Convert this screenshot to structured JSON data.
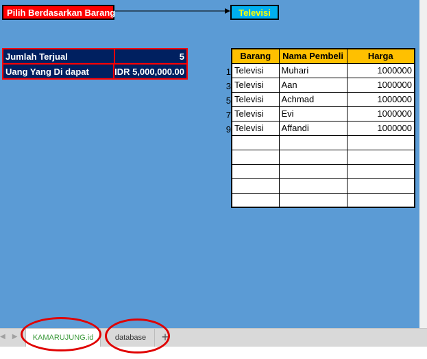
{
  "filter": {
    "label": "Pilih Berdasarkan Barang",
    "value": "Televisi"
  },
  "summary": {
    "sold_label": "Jumlah Terjual",
    "sold_value": "5",
    "money_label": "Uang Yang Di dapat",
    "money_value": "IDR 5,000,000.00"
  },
  "table": {
    "headers": [
      "Barang",
      "Nama Pembeli",
      "Harga"
    ],
    "rows": [
      {
        "num": "1",
        "barang": "Televisi",
        "nama": "Muhari",
        "harga": "1000000"
      },
      {
        "num": "3",
        "barang": "Televisi",
        "nama": "Aan",
        "harga": "1000000"
      },
      {
        "num": "5",
        "barang": "Televisi",
        "nama": "Achmad",
        "harga": "1000000"
      },
      {
        "num": "7",
        "barang": "Televisi",
        "nama": "Evi",
        "harga": "1000000"
      },
      {
        "num": "9",
        "barang": "Televisi",
        "nama": "Affandi",
        "harga": "1000000"
      }
    ]
  },
  "tabs": {
    "active": "KAMARUJUNG.id",
    "other": "database",
    "add": "+"
  },
  "colors": {
    "sheet_bg": "#5b9bd5",
    "label_bg": "#ff0000",
    "value_bg": "#00b0f0",
    "value_text": "#ffff00",
    "summary_bg": "#002060",
    "header_bg": "#ffc000",
    "annotation_circle": "#e00000"
  }
}
